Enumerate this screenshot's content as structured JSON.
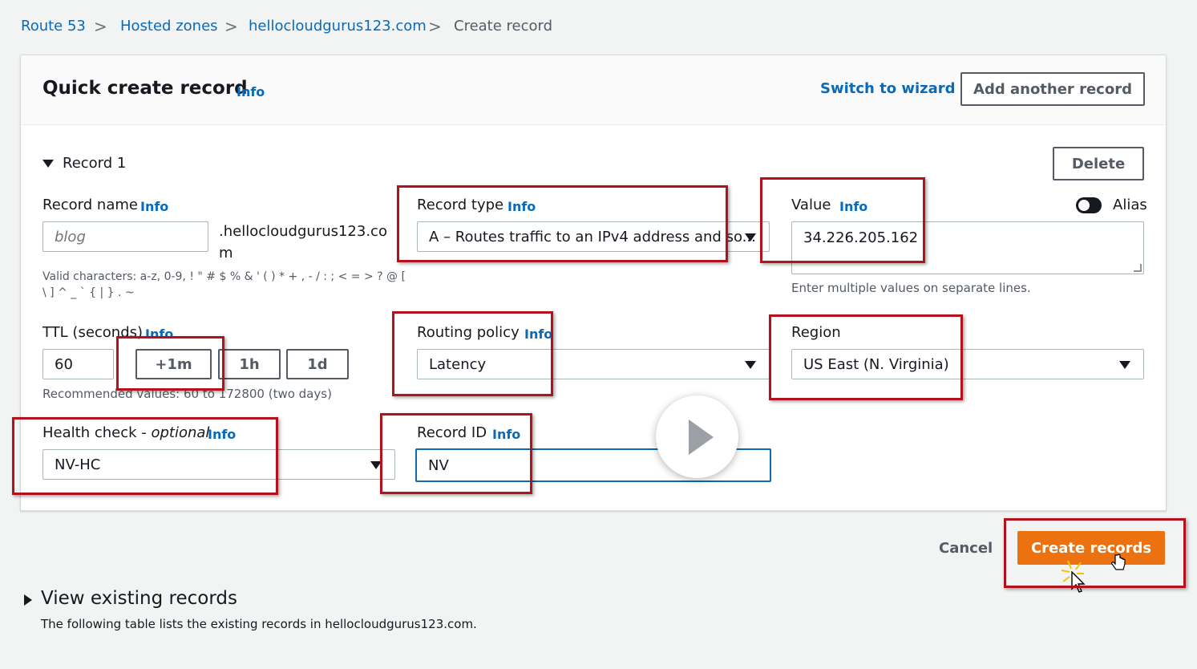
{
  "breadcrumb": {
    "items": [
      "Route 53",
      "Hosted zones",
      "hellocloudgurus123.com",
      "Create record"
    ],
    "separator": ">"
  },
  "header": {
    "title": "Quick create record",
    "info": "Info",
    "switch_wizard": "Switch to wizard",
    "add_another": "Add another record"
  },
  "record": {
    "toggle_label": "Record 1",
    "delete": "Delete",
    "name": {
      "label": "Record name",
      "info": "Info",
      "placeholder": "blog",
      "suffix_line1": ".hellocloudgurus123.co",
      "suffix_line2": "m",
      "hint_line1": "Valid characters: a-z, 0-9, ! \" # $ % & ' ( ) * + , - / : ; < = > ? @ [",
      "hint_line2": "\\ ] ^ _ ` { | } . ~"
    },
    "type": {
      "label": "Record type",
      "info": "Info",
      "value": "A – Routes traffic to an IPv4 address and so..."
    },
    "value": {
      "label": "Value",
      "info": "Info",
      "text": "34.226.205.162",
      "hint": "Enter multiple values on separate lines.",
      "alias_label": "Alias"
    },
    "ttl": {
      "label": "TTL (seconds)",
      "info": "Info",
      "value": "60",
      "buttons": [
        "+1m",
        "1h",
        "1d"
      ],
      "hint": "Recommended values: 60 to 172800 (two days)"
    },
    "routing": {
      "label": "Routing policy",
      "info": "Info",
      "value": "Latency"
    },
    "region": {
      "label": "Region",
      "value": "US East (N. Virginia)"
    },
    "health": {
      "label": "Health check - ",
      "label_optional": "optional",
      "info": "Info",
      "value": "NV-HC"
    },
    "record_id": {
      "label": "Record ID",
      "info": "Info",
      "value": "NV"
    }
  },
  "footer": {
    "cancel": "Cancel",
    "create": "Create records"
  },
  "existing": {
    "title": "View existing records",
    "description": "The following table lists the existing records in hellocloudgurus123.com."
  },
  "colors": {
    "link": "#0a6ab8",
    "primary": "#ec7211",
    "annotation": "#b3111c",
    "focus": "#0a6ab8"
  }
}
